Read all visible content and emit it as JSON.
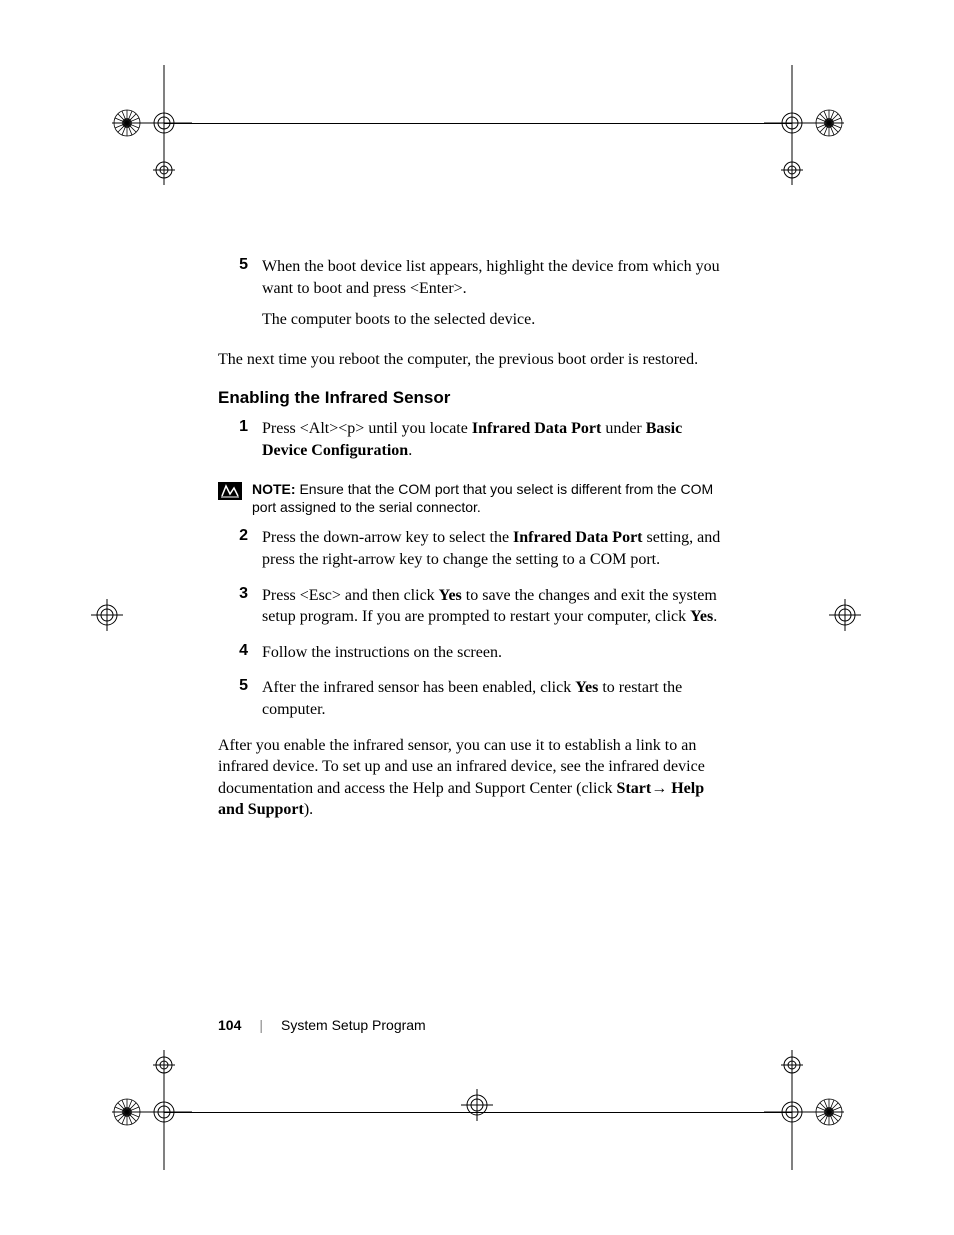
{
  "step5_num": "5",
  "step5_p1a": "When the boot device list appears, highlight the device from which you want to boot and press <Enter>.",
  "step5_p2": "The computer boots to the selected device.",
  "para_reboot": "The next time you reboot the computer, the previous boot order is restored.",
  "heading": "Enabling the Infrared Sensor",
  "s1_num": "1",
  "s1_pre": "Press <Alt><p> until you locate ",
  "s1_b1": "Infrared Data Port",
  "s1_mid": " under ",
  "s1_b2": "Basic Device Configuration",
  "s1_post": ".",
  "note_label": "NOTE:",
  "note_text": " Ensure that the COM port that you select is different from the COM port assigned to the serial connector.",
  "s2_num": "2",
  "s2_pre": "Press the down-arrow key to select the ",
  "s2_b1": "Infrared Data Port",
  "s2_post": " setting, and press the right-arrow key to change the setting to a COM port.",
  "s3_num": "3",
  "s3_pre": "Press <Esc> and then click ",
  "s3_b1": "Yes",
  "s3_mid": " to save the changes and exit the system setup program. If you are prompted to restart your computer, click ",
  "s3_b2": "Yes",
  "s3_post": ".",
  "s4_num": "4",
  "s4_text": "Follow the instructions on the screen.",
  "s5_num": "5",
  "s5_pre": "After the infrared sensor has been enabled, click ",
  "s5_b1": "Yes",
  "s5_post": " to restart the computer.",
  "closing_pre": "After you enable the infrared sensor, you can use it to establish a link to an infrared device. To set up and use an infrared device, see the infrared device documentation and access the Help and Support Center (click ",
  "closing_b1": "Start",
  "closing_arrow": "→ ",
  "closing_b2": "Help and Support",
  "closing_post": ").",
  "page_num": "104",
  "footer_sep": "|",
  "footer_title": "System Setup Program"
}
